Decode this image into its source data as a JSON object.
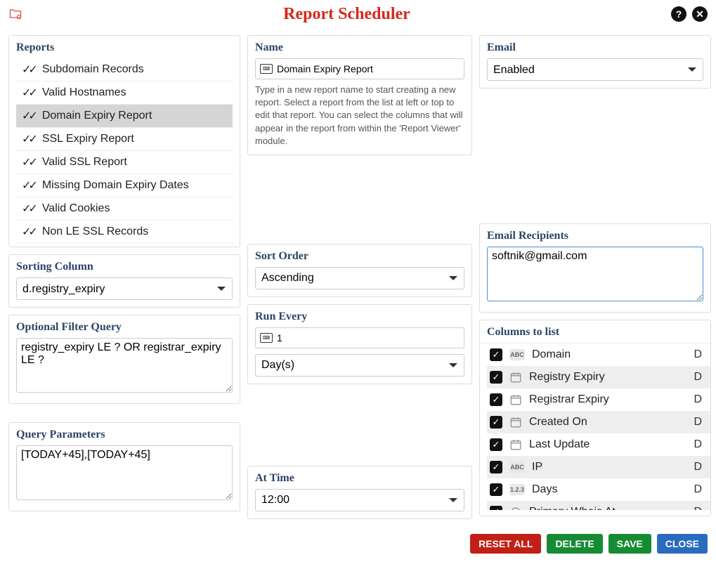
{
  "header": {
    "title": "Report Scheduler"
  },
  "reports": {
    "title": "Reports",
    "items": [
      {
        "label": "Subdomain Records",
        "selected": false
      },
      {
        "label": "Valid Hostnames",
        "selected": false
      },
      {
        "label": "Domain Expiry Report",
        "selected": true
      },
      {
        "label": "SSL Expiry Report",
        "selected": false
      },
      {
        "label": "Valid SSL Report",
        "selected": false
      },
      {
        "label": "Missing Domain Expiry Dates",
        "selected": false
      },
      {
        "label": "Valid Cookies",
        "selected": false
      },
      {
        "label": "Non LE SSL Records",
        "selected": false
      }
    ]
  },
  "name": {
    "title": "Name",
    "value": "Domain Expiry Report",
    "desc": "Type in a new report name to start creating a new report. Select a report from the list at left or top to edit that report. You can select the columns that will appear in the report from within the 'Report Viewer' module."
  },
  "email": {
    "title": "Email",
    "value": "Enabled"
  },
  "email_recipients": {
    "title": "Email Recipients",
    "value": "softnik@gmail.com"
  },
  "sorting_column": {
    "title": "Sorting Column",
    "value": "d.registry_expiry"
  },
  "sort_order": {
    "title": "Sort Order",
    "value": "Ascending"
  },
  "filter_query": {
    "title": "Optional Filter Query",
    "value": "registry_expiry LE ? OR registrar_expiry LE ?"
  },
  "run_every": {
    "title": "Run Every",
    "count": "1",
    "unit": "Day(s)"
  },
  "query_params": {
    "title": "Query Parameters",
    "value": "[TODAY+45],[TODAY+45]"
  },
  "at_time": {
    "title": "At Time",
    "value": "12:00"
  },
  "columns": {
    "title": "Columns to list",
    "items": [
      {
        "label": "Domain",
        "type": "abc",
        "d": "D",
        "checked": true
      },
      {
        "label": "Registry Expiry",
        "type": "cal",
        "d": "D",
        "checked": true
      },
      {
        "label": "Registrar Expiry",
        "type": "cal",
        "d": "D",
        "checked": true
      },
      {
        "label": "Created On",
        "type": "cal",
        "d": "D",
        "checked": true
      },
      {
        "label": "Last Update",
        "type": "cal",
        "d": "D",
        "checked": true
      },
      {
        "label": "IP",
        "type": "abc",
        "d": "D",
        "checked": true
      },
      {
        "label": "Days",
        "type": "num",
        "d": "D",
        "checked": true
      },
      {
        "label": "Primary Whois At",
        "type": "clock",
        "d": "D",
        "checked": true
      }
    ]
  },
  "footer": {
    "reset": "RESET ALL",
    "delete": "DELETE",
    "save": "SAVE",
    "close": "CLOSE"
  }
}
